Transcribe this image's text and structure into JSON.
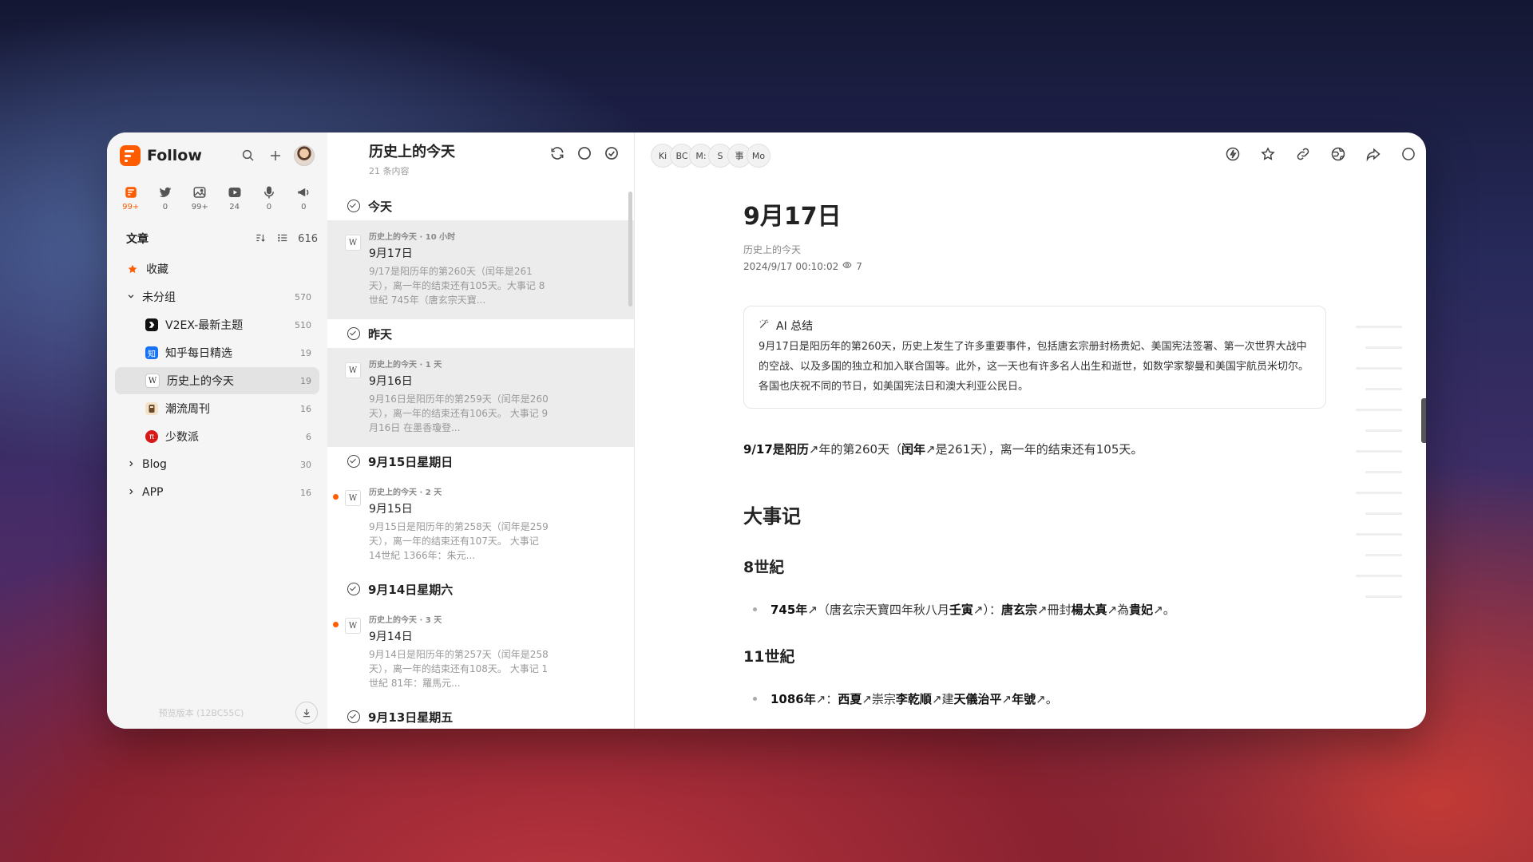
{
  "sidebar": {
    "app_name": "Follow",
    "views": [
      {
        "icon": "article-icon",
        "count": "99+"
      },
      {
        "icon": "twitter-icon",
        "count": "0"
      },
      {
        "icon": "image-icon",
        "count": "99+"
      },
      {
        "icon": "video-icon",
        "count": "24"
      },
      {
        "icon": "microphone-icon",
        "count": "0"
      },
      {
        "icon": "megaphone-icon",
        "count": "0"
      }
    ],
    "section_title": "文章",
    "section_count": "616",
    "items": [
      {
        "label": "收藏",
        "count": ""
      },
      {
        "label": "未分组",
        "count": "570"
      },
      {
        "label": "V2EX-最新主题",
        "count": "510"
      },
      {
        "label": "知乎每日精选",
        "count": "19"
      },
      {
        "label": "历史上的今天",
        "count": "19"
      },
      {
        "label": "潮流周刊",
        "count": "16"
      },
      {
        "label": "少数派",
        "count": "6"
      },
      {
        "label": "Blog",
        "count": "30"
      },
      {
        "label": "APP",
        "count": "16"
      }
    ],
    "zhihu_badge": "知",
    "wiki_badge": "W",
    "sspai_badge": "π",
    "version": "预览版本 (12BC55C)"
  },
  "list": {
    "title": "历史上的今天",
    "subtitle": "21 条内容",
    "groups": [
      {
        "label": "今天",
        "entry": {
          "meta": "历史上的今天 · 10 小时",
          "title": "9月17日",
          "desc": "9/17是阳历年的第260天（闰年是261天），离一年的结束还有105天。大事记 8世紀 745年（唐玄宗天寶..."
        }
      },
      {
        "label": "昨天",
        "entry": {
          "meta": "历史上的今天 · 1 天",
          "title": "9月16日",
          "desc": "9月16日是阳历年的第259天（闰年是260天），离一年的结束还有106天。 大事记 9月16日 在墨香瓊登..."
        }
      },
      {
        "label": "9月15日星期日",
        "entry": {
          "meta": "历史上的今天 · 2 天",
          "title": "9月15日",
          "desc": "9月15日是阳历年的第258天（闰年是259天），离一年的结束还有107天。 大事记 14世紀 1366年：朱元..."
        }
      },
      {
        "label": "9月14日星期六",
        "entry": {
          "meta": "历史上的今天 · 3 天",
          "title": "9月14日",
          "desc": "9月14日是阳历年的第257天（闰年是258天），离一年的结束还有108天。 大事记 1世紀 81年：羅馬元..."
        }
      },
      {
        "label": "9月13日星期五"
      }
    ],
    "wiki_badge": "W"
  },
  "content": {
    "chips": [
      "Ki",
      "BC",
      "M:",
      "S",
      "事",
      "Mo"
    ],
    "title": "9月17日",
    "feed": "历史上的今天",
    "date": "2024/9/17 00:10:02",
    "views": "7",
    "ai_title": "AI 总结",
    "ai_summary": "9月17日是阳历年的第260天，历史上发生了许多重要事件，包括唐玄宗册封杨贵妃、美国宪法签署、第一次世界大战中的空战、以及多国的独立和加入联合国等。此外，这一天也有许多名人出生和逝世，如数学家黎曼和美国宇航员米切尔。各国也庆祝不同的节日，如美国宪法日和澳大利亚公民日。",
    "intro": {
      "a": "9/17",
      "b": "是",
      "c": "阳历",
      "d": "↗年的第260天（",
      "e": "闰年",
      "f": "↗是261天），离一年的结束还有105天。"
    },
    "h2": "大事记",
    "h3_1": "8世紀",
    "b1": {
      "a": "745年",
      "b": "↗（唐玄宗天寶四年秋八月",
      "c": "壬寅",
      "d": "↗）：",
      "e": "唐玄宗",
      "f": "↗冊封",
      "g": "楊太真",
      "h": "↗為",
      "i": "貴妃",
      "j": "↗。"
    },
    "h3_2": "11世紀",
    "b2": {
      "a": "1086年",
      "b": "↗：",
      "c": "西夏",
      "d": "↗崇宗",
      "e": "李乾順",
      "f": "↗建",
      "g": "天儀治平",
      "h": "↗",
      "i": "年號",
      "j": "↗。"
    }
  },
  "colors": {
    "accent": "#ff5c00",
    "sidebar_bg": "#f5f5f5",
    "selected_bg": "#e3e3e3"
  }
}
